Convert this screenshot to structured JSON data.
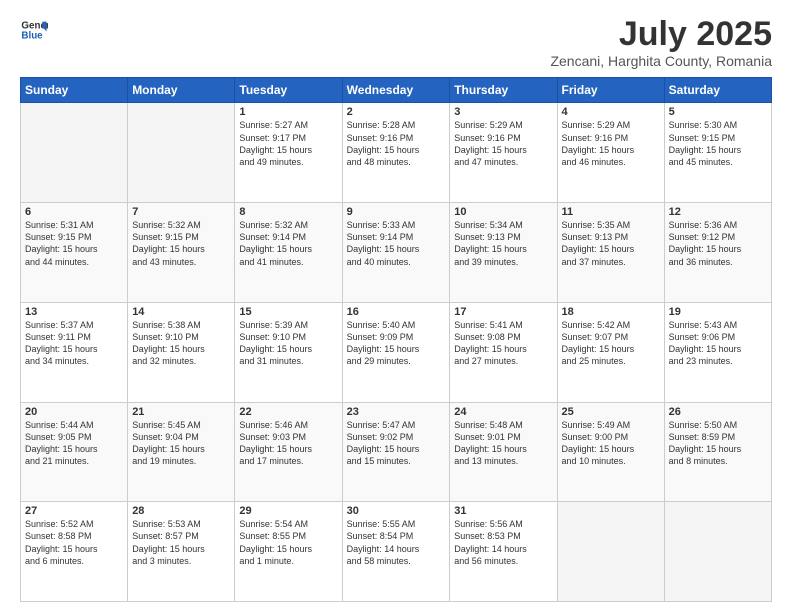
{
  "header": {
    "logo_line1": "General",
    "logo_line2": "Blue",
    "month": "July 2025",
    "location": "Zencani, Harghita County, Romania"
  },
  "weekdays": [
    "Sunday",
    "Monday",
    "Tuesday",
    "Wednesday",
    "Thursday",
    "Friday",
    "Saturday"
  ],
  "weeks": [
    [
      {
        "day": "",
        "info": ""
      },
      {
        "day": "",
        "info": ""
      },
      {
        "day": "1",
        "info": "Sunrise: 5:27 AM\nSunset: 9:17 PM\nDaylight: 15 hours\nand 49 minutes."
      },
      {
        "day": "2",
        "info": "Sunrise: 5:28 AM\nSunset: 9:16 PM\nDaylight: 15 hours\nand 48 minutes."
      },
      {
        "day": "3",
        "info": "Sunrise: 5:29 AM\nSunset: 9:16 PM\nDaylight: 15 hours\nand 47 minutes."
      },
      {
        "day": "4",
        "info": "Sunrise: 5:29 AM\nSunset: 9:16 PM\nDaylight: 15 hours\nand 46 minutes."
      },
      {
        "day": "5",
        "info": "Sunrise: 5:30 AM\nSunset: 9:15 PM\nDaylight: 15 hours\nand 45 minutes."
      }
    ],
    [
      {
        "day": "6",
        "info": "Sunrise: 5:31 AM\nSunset: 9:15 PM\nDaylight: 15 hours\nand 44 minutes."
      },
      {
        "day": "7",
        "info": "Sunrise: 5:32 AM\nSunset: 9:15 PM\nDaylight: 15 hours\nand 43 minutes."
      },
      {
        "day": "8",
        "info": "Sunrise: 5:32 AM\nSunset: 9:14 PM\nDaylight: 15 hours\nand 41 minutes."
      },
      {
        "day": "9",
        "info": "Sunrise: 5:33 AM\nSunset: 9:14 PM\nDaylight: 15 hours\nand 40 minutes."
      },
      {
        "day": "10",
        "info": "Sunrise: 5:34 AM\nSunset: 9:13 PM\nDaylight: 15 hours\nand 39 minutes."
      },
      {
        "day": "11",
        "info": "Sunrise: 5:35 AM\nSunset: 9:13 PM\nDaylight: 15 hours\nand 37 minutes."
      },
      {
        "day": "12",
        "info": "Sunrise: 5:36 AM\nSunset: 9:12 PM\nDaylight: 15 hours\nand 36 minutes."
      }
    ],
    [
      {
        "day": "13",
        "info": "Sunrise: 5:37 AM\nSunset: 9:11 PM\nDaylight: 15 hours\nand 34 minutes."
      },
      {
        "day": "14",
        "info": "Sunrise: 5:38 AM\nSunset: 9:10 PM\nDaylight: 15 hours\nand 32 minutes."
      },
      {
        "day": "15",
        "info": "Sunrise: 5:39 AM\nSunset: 9:10 PM\nDaylight: 15 hours\nand 31 minutes."
      },
      {
        "day": "16",
        "info": "Sunrise: 5:40 AM\nSunset: 9:09 PM\nDaylight: 15 hours\nand 29 minutes."
      },
      {
        "day": "17",
        "info": "Sunrise: 5:41 AM\nSunset: 9:08 PM\nDaylight: 15 hours\nand 27 minutes."
      },
      {
        "day": "18",
        "info": "Sunrise: 5:42 AM\nSunset: 9:07 PM\nDaylight: 15 hours\nand 25 minutes."
      },
      {
        "day": "19",
        "info": "Sunrise: 5:43 AM\nSunset: 9:06 PM\nDaylight: 15 hours\nand 23 minutes."
      }
    ],
    [
      {
        "day": "20",
        "info": "Sunrise: 5:44 AM\nSunset: 9:05 PM\nDaylight: 15 hours\nand 21 minutes."
      },
      {
        "day": "21",
        "info": "Sunrise: 5:45 AM\nSunset: 9:04 PM\nDaylight: 15 hours\nand 19 minutes."
      },
      {
        "day": "22",
        "info": "Sunrise: 5:46 AM\nSunset: 9:03 PM\nDaylight: 15 hours\nand 17 minutes."
      },
      {
        "day": "23",
        "info": "Sunrise: 5:47 AM\nSunset: 9:02 PM\nDaylight: 15 hours\nand 15 minutes."
      },
      {
        "day": "24",
        "info": "Sunrise: 5:48 AM\nSunset: 9:01 PM\nDaylight: 15 hours\nand 13 minutes."
      },
      {
        "day": "25",
        "info": "Sunrise: 5:49 AM\nSunset: 9:00 PM\nDaylight: 15 hours\nand 10 minutes."
      },
      {
        "day": "26",
        "info": "Sunrise: 5:50 AM\nSunset: 8:59 PM\nDaylight: 15 hours\nand 8 minutes."
      }
    ],
    [
      {
        "day": "27",
        "info": "Sunrise: 5:52 AM\nSunset: 8:58 PM\nDaylight: 15 hours\nand 6 minutes."
      },
      {
        "day": "28",
        "info": "Sunrise: 5:53 AM\nSunset: 8:57 PM\nDaylight: 15 hours\nand 3 minutes."
      },
      {
        "day": "29",
        "info": "Sunrise: 5:54 AM\nSunset: 8:55 PM\nDaylight: 15 hours\nand 1 minute."
      },
      {
        "day": "30",
        "info": "Sunrise: 5:55 AM\nSunset: 8:54 PM\nDaylight: 14 hours\nand 58 minutes."
      },
      {
        "day": "31",
        "info": "Sunrise: 5:56 AM\nSunset: 8:53 PM\nDaylight: 14 hours\nand 56 minutes."
      },
      {
        "day": "",
        "info": ""
      },
      {
        "day": "",
        "info": ""
      }
    ]
  ]
}
